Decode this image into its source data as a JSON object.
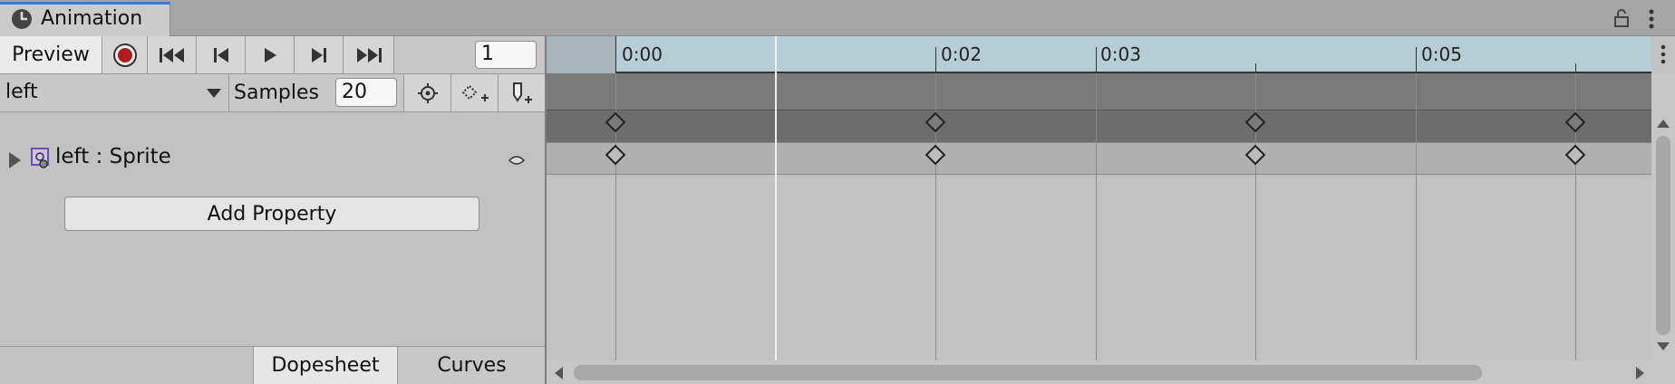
{
  "window": {
    "tab_title": "Animation",
    "tab_icon": "clock-icon"
  },
  "toolbar": {
    "preview_label": "Preview",
    "record_icon": "record-icon",
    "first_key_icon": "first-key-icon",
    "prev_key_icon": "prev-key-icon",
    "play_icon": "play-icon",
    "next_key_icon": "next-key-icon",
    "last_key_icon": "last-key-icon",
    "frame_value": "1",
    "record_color": "#b01c1c"
  },
  "clip_bar": {
    "clip_name": "left",
    "samples_label": "Samples",
    "samples_value": "20",
    "filter_icon": "filter-by-selection-icon",
    "add_keyframe_icon": "add-keyframe-icon",
    "add_event_icon": "add-event-icon"
  },
  "properties": {
    "rows": [
      {
        "label": "left : Sprite",
        "icon": "sprite-renderer-icon"
      }
    ],
    "add_property_label": "Add Property"
  },
  "bottom_tabs": {
    "dopesheet": "Dopesheet",
    "curves": "Curves",
    "active": "Dopesheet"
  },
  "timeline": {
    "ruler_labels": [
      "0:00",
      "0:02",
      "0:03",
      "0:05"
    ],
    "keyframe_times_seconds": [
      0,
      1.5,
      3,
      4.5
    ],
    "ruler_color": "#b5ced6"
  }
}
